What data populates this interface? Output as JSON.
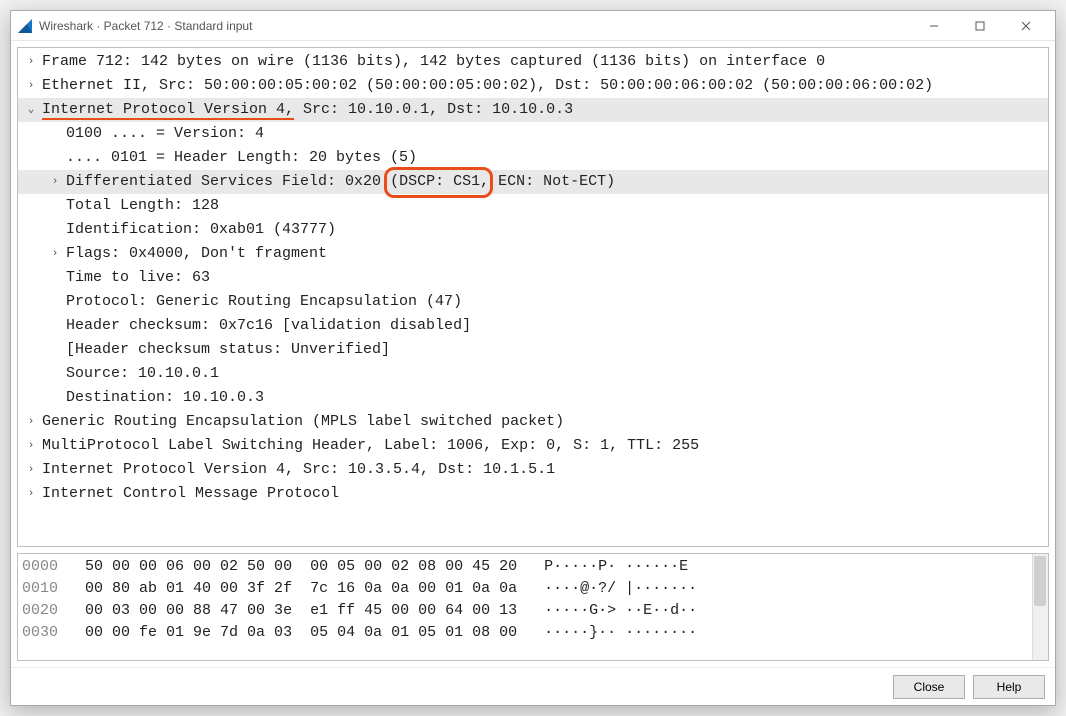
{
  "window": {
    "title": "Wireshark · Packet 712 · Standard input"
  },
  "tree": {
    "frame": "Frame 712: 142 bytes on wire (1136 bits), 142 bytes captured (1136 bits) on interface 0",
    "eth": "Ethernet II, Src: 50:00:00:05:00:02 (50:00:00:05:00:02), Dst: 50:00:00:06:00:02 (50:00:00:06:00:02)",
    "ip_header_label": "Internet Protocol Version 4,",
    "ip_header_rest": " Src: 10.10.0.1, Dst: 10.10.0.3",
    "ip": {
      "version": "0100 .... = Version: 4",
      "hdrlen": ".... 0101 = Header Length: 20 bytes (5)",
      "dsf_pre": "Differentiated Services Field: 0x20 ",
      "dsf_circled": "(DSCP: CS1,",
      "dsf_post": " ECN: Not-ECT)",
      "totlen": "Total Length: 128",
      "id": "Identification: 0xab01 (43777)",
      "flags": "Flags: 0x4000, Don't fragment",
      "ttl": "Time to live: 63",
      "proto": "Protocol: Generic Routing Encapsulation (47)",
      "cksum": "Header checksum: 0x7c16 [validation disabled]",
      "cksum_status": "[Header checksum status: Unverified]",
      "src": "Source: 10.10.0.1",
      "dst": "Destination: 10.10.0.3"
    },
    "gre": "Generic Routing Encapsulation (MPLS label switched packet)",
    "mpls": "MultiProtocol Label Switching Header, Label: 1006, Exp: 0, S: 1, TTL: 255",
    "ip2": "Internet Protocol Version 4, Src: 10.3.5.4, Dst: 10.1.5.1",
    "icmp": "Internet Control Message Protocol"
  },
  "hex": {
    "rows": [
      {
        "off": "0000",
        "bytes": "50 00 00 06 00 02 50 00  00 05 00 02 08 00 45 20",
        "ascii": "P·····P· ······E "
      },
      {
        "off": "0010",
        "bytes": "00 80 ab 01 40 00 3f 2f  7c 16 0a 0a 00 01 0a 0a",
        "ascii": "····@·?/ |·······"
      },
      {
        "off": "0020",
        "bytes": "00 03 00 00 88 47 00 3e  e1 ff 45 00 00 64 00 13",
        "ascii": "·····G·> ··E··d··"
      },
      {
        "off": "0030",
        "bytes": "00 00 fe 01 9e 7d 0a 03  05 04 0a 01 05 01 08 00",
        "ascii": "·····}·· ········"
      }
    ]
  },
  "buttons": {
    "close": "Close",
    "help": "Help"
  },
  "glyphs": {
    "right": "›",
    "down": "⌄"
  }
}
